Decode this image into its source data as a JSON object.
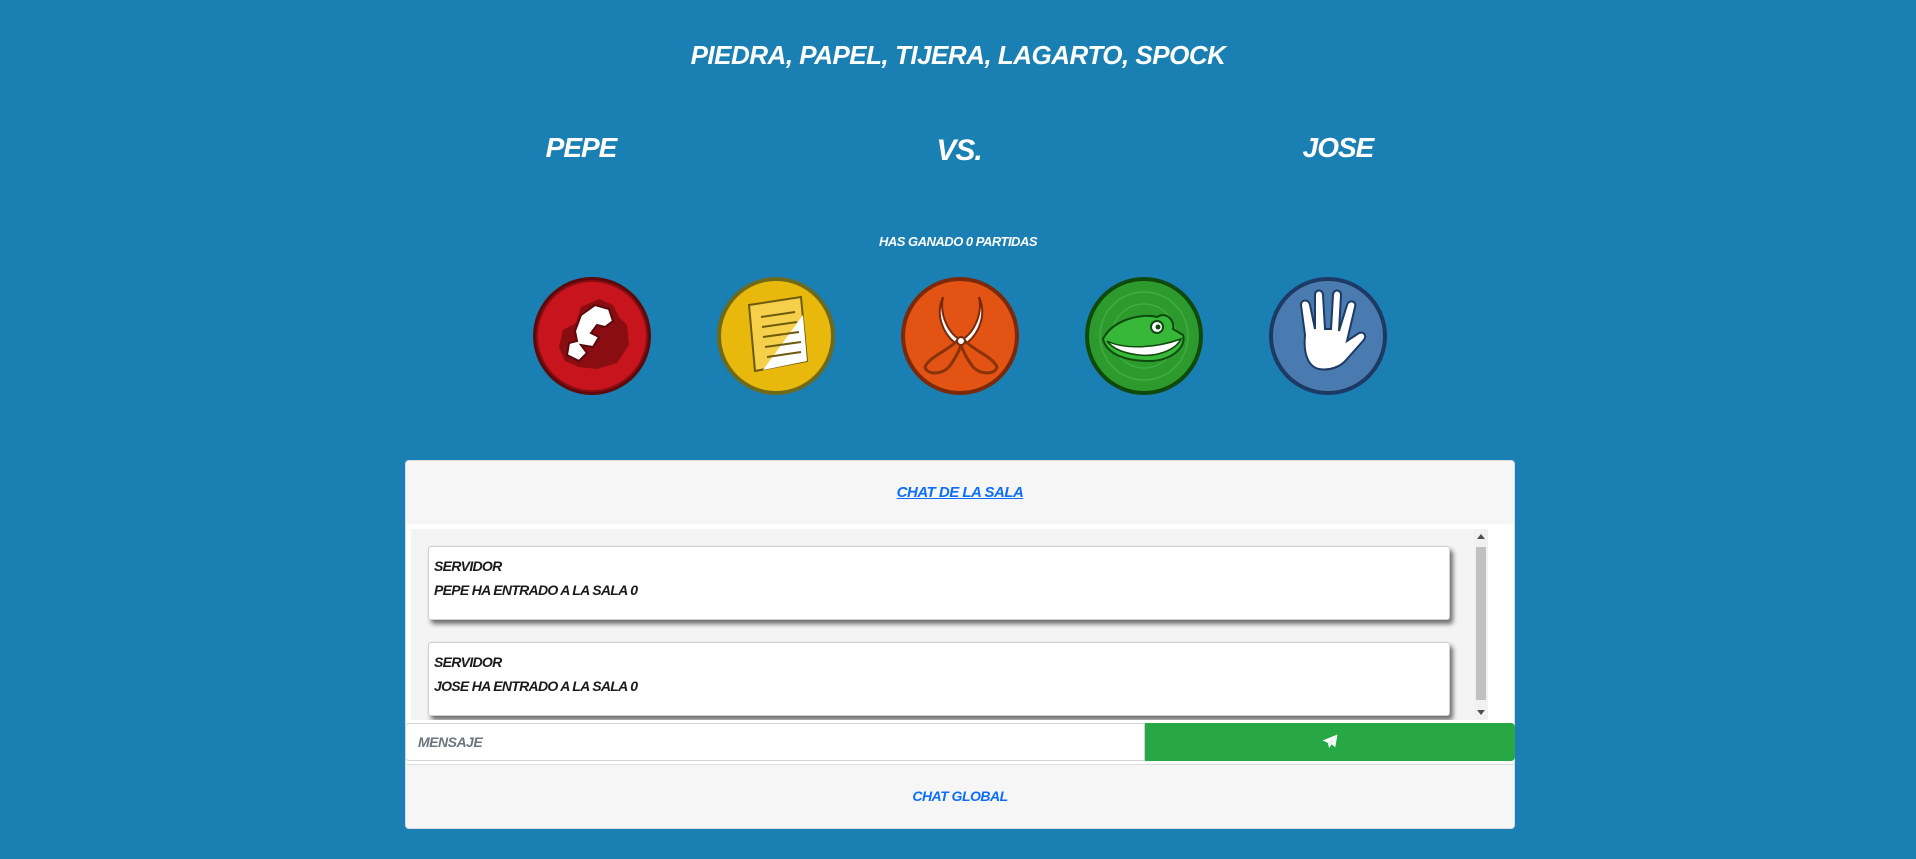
{
  "game": {
    "title": "PIEDRA, PAPEL, TIJERA, LAGARTO, SPOCK",
    "player1": "PEPE",
    "vs": "VS.",
    "player2": "JOSE",
    "wins_text": "HAS GANADO 0 PARTIDAS",
    "choices": [
      {
        "name": "piedra",
        "icon": "rock-icon",
        "color": "#c8141c"
      },
      {
        "name": "papel",
        "icon": "paper-icon",
        "color": "#e8b90c"
      },
      {
        "name": "tijera",
        "icon": "scissors-icon",
        "color": "#e35314"
      },
      {
        "name": "lagarto",
        "icon": "lizard-icon",
        "color": "#2c9a2c"
      },
      {
        "name": "spock",
        "icon": "spock-icon",
        "color": "#4a7bb0"
      }
    ]
  },
  "chat": {
    "header": "CHAT DE LA SALA",
    "messages": [
      {
        "author": "SERVIDOR",
        "text": "PEPE HA ENTRADO A LA SALA 0"
      },
      {
        "author": "SERVIDOR",
        "text": "JOSE HA ENTRADO A LA SALA 0"
      }
    ],
    "input_placeholder": "MENSAJE",
    "send_icon": "paper-plane-icon",
    "global_label": "CHAT GLOBAL"
  },
  "colors": {
    "background": "#1a7fb2",
    "send_button": "#28a745",
    "link": "#0d6efd"
  }
}
